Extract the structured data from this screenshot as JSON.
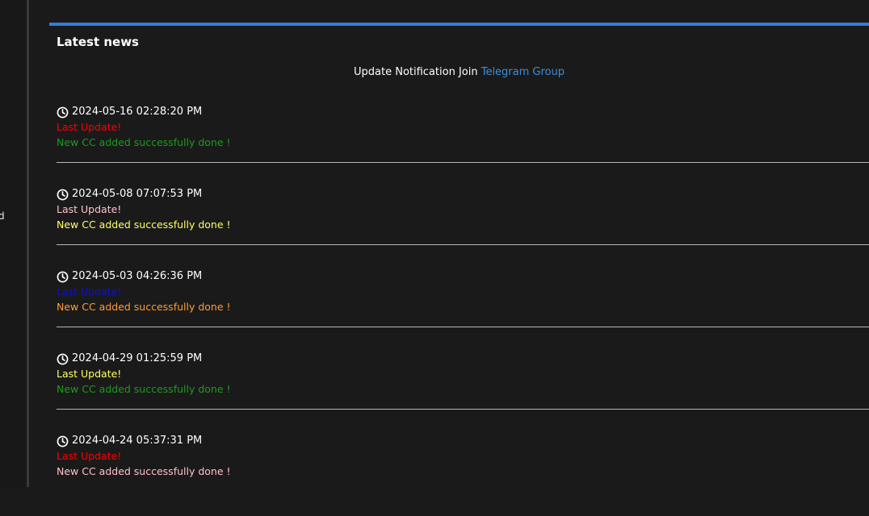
{
  "sidebar": {
    "fragment_text": "d"
  },
  "accent_color": "#2f7fd6",
  "panel": {
    "title": "Latest news"
  },
  "notice": {
    "text": "Update Notification Join ",
    "link_text": "Telegram Group"
  },
  "news_items": [
    {
      "date": "2024-05-16 02:28:20 PM",
      "title": "Last Update!",
      "title_color": "#ff0000",
      "message": "New CC added successfully done !",
      "message_color": "#1f9a1f"
    },
    {
      "date": "2024-05-08 07:07:53 PM",
      "title": "Last Update!",
      "title_color": "#ffc0cb",
      "message": "New CC added successfully done !",
      "message_color": "#ffff66"
    },
    {
      "date": "2024-05-03 04:26:36 PM",
      "title": "Last Update!",
      "title_color": "#1010d0",
      "message": "New CC added successfully done !",
      "message_color": "#ff9c33"
    },
    {
      "date": "2024-04-29 01:25:59 PM",
      "title": "Last Update!",
      "title_color": "#ffff66",
      "message": "New CC added successfully done !",
      "message_color": "#1f9a1f"
    },
    {
      "date": "2024-04-24 05:37:31 PM",
      "title": "Last Update!",
      "title_color": "#ff0000",
      "message": "New CC added successfully done !",
      "message_color": "#ffc0cb"
    }
  ],
  "icons": {
    "clock": "clock-icon"
  }
}
